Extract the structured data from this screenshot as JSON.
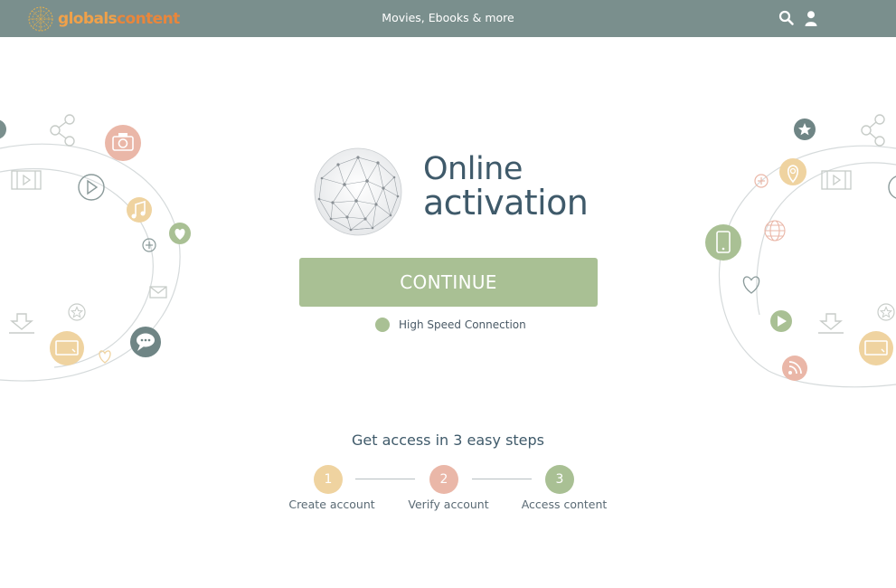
{
  "brand": {
    "part1": "globals",
    "part2": "content",
    "color_primary": "#f0a14a",
    "color_secondary": "#e8863c"
  },
  "header": {
    "background": "#7a8f8d",
    "tagline": "Movies, Ebooks & more",
    "icons": [
      "search-icon",
      "user-icon"
    ]
  },
  "hero": {
    "title_line1": "Online",
    "title_line2": "activation",
    "title_color": "#3f5a6a"
  },
  "cta": {
    "label": "CONTINUE",
    "color": "#a9c094"
  },
  "connection": {
    "label": "High Speed Connection"
  },
  "steps": {
    "title": "Get access in 3 easy steps",
    "items": [
      {
        "number": "1",
        "label": "Create account",
        "color": "#efd3a0"
      },
      {
        "number": "2",
        "label": "Verify account",
        "color": "#eab7a8"
      },
      {
        "number": "3",
        "label": "Access content",
        "color": "#a9c094"
      }
    ]
  },
  "decorations": {
    "left_icons": [
      "share-icon",
      "camera-icon",
      "film-icon",
      "play-icon",
      "music-note-icon",
      "heart-icon",
      "plus-icon",
      "mail-icon",
      "star-icon",
      "download-icon",
      "screen-icon",
      "chat-icon",
      "heart-outline-icon"
    ],
    "right_icons": [
      "star-icon",
      "share-icon",
      "location-icon",
      "plus-icon",
      "film-icon",
      "globe-icon",
      "phone-icon",
      "heart-outline-icon",
      "play-icon",
      "download-icon",
      "star-icon",
      "screen-icon",
      "rss-icon"
    ]
  }
}
